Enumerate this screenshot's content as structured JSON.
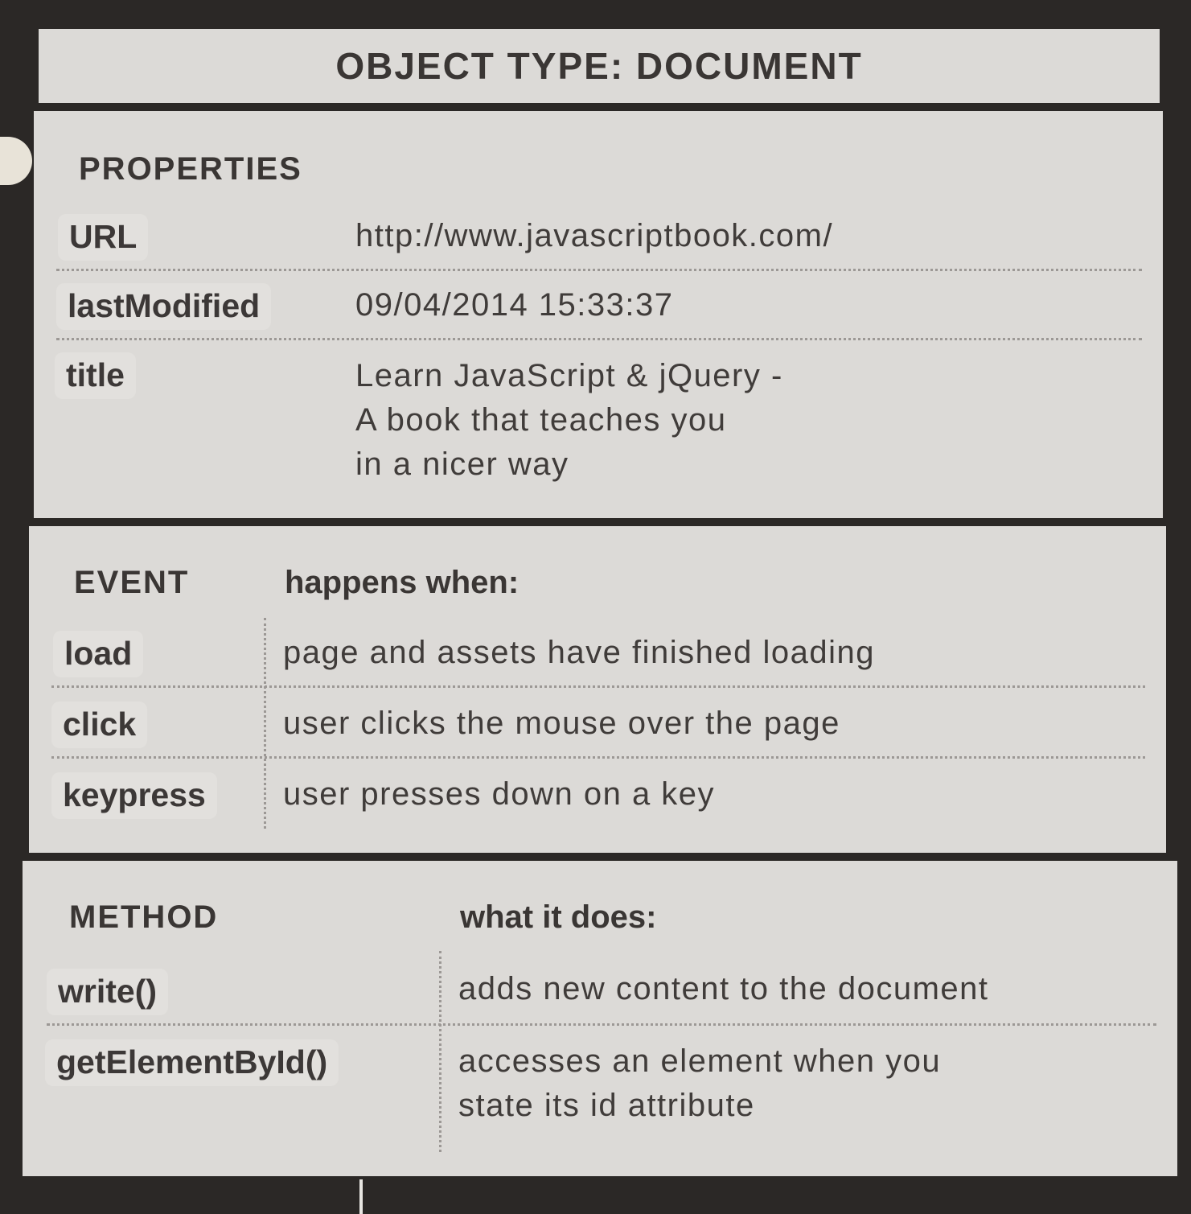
{
  "header": {
    "title": "OBJECT TYPE: DOCUMENT"
  },
  "properties": {
    "heading": "PROPERTIES",
    "rows": [
      {
        "key": "URL",
        "value": "http://www.javascriptbook.com/"
      },
      {
        "key": "lastModified",
        "value": "09/04/2014 15:33:37"
      },
      {
        "key": "title",
        "value": "Learn JavaScript & jQuery -\nA book that teaches you\nin a nicer way"
      }
    ]
  },
  "events": {
    "heading": "EVENT",
    "column_heading": "happens when:",
    "rows": [
      {
        "key": "load",
        "value": "page and assets have finished loading"
      },
      {
        "key": "click",
        "value": "user clicks the mouse over the page"
      },
      {
        "key": "keypress",
        "value": "user presses down on a key"
      }
    ]
  },
  "methods": {
    "heading": "METHOD",
    "column_heading": "what it does:",
    "rows": [
      {
        "key": "write()",
        "value": "adds new content to the document"
      },
      {
        "key": "getElementById()",
        "value": "accesses an element when you\nstate its id attribute"
      }
    ]
  }
}
